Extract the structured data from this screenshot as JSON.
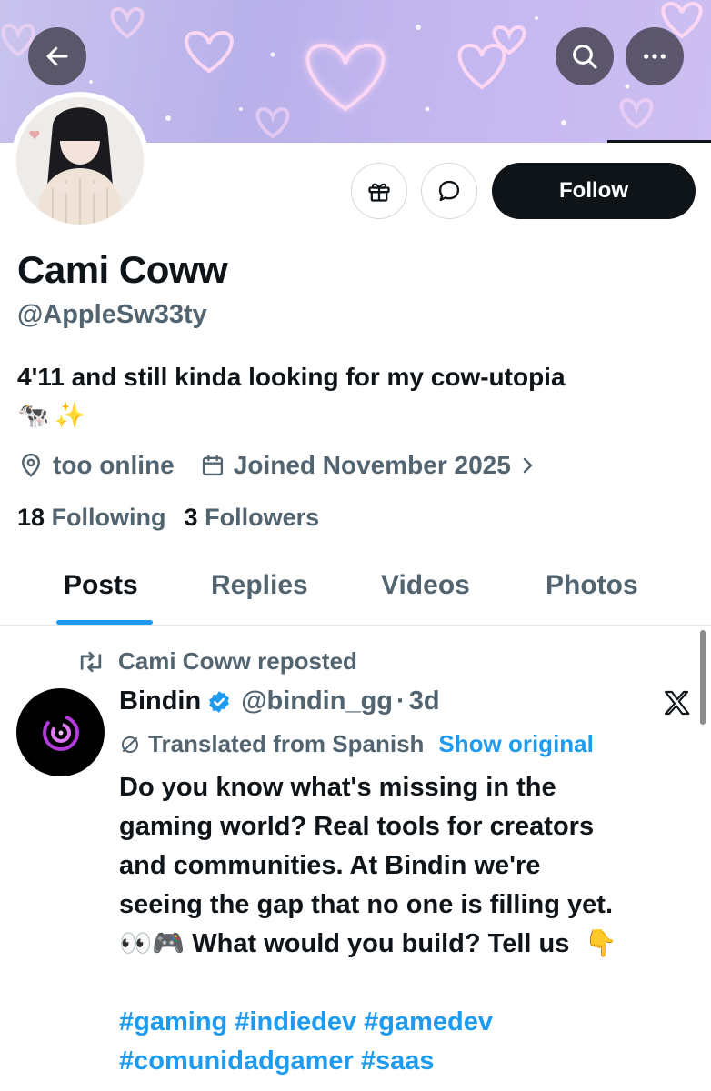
{
  "header": {
    "back_icon": "arrow-left-icon",
    "search_icon": "search-icon",
    "more_icon": "more-horizontal-icon"
  },
  "profile": {
    "name": "Cami Coww",
    "handle": "@AppleSw33ty",
    "bio": "4'11 and still kinda looking for my cow-utopia",
    "bio_emoji": [
      "🐄",
      "✨"
    ],
    "location": "too online",
    "joined": "Joined November 2025"
  },
  "actions": {
    "gift_icon": "gift-icon",
    "message_icon": "message-icon",
    "follow_label": "Follow"
  },
  "counts": {
    "following_count": "18",
    "following_label": "Following",
    "followers_count": "3",
    "followers_label": "Followers"
  },
  "tabs": [
    {
      "label": "Posts",
      "active": true
    },
    {
      "label": "Replies",
      "active": false
    },
    {
      "label": "Videos",
      "active": false
    },
    {
      "label": "Photos",
      "active": false
    }
  ],
  "post": {
    "repost_text": "Cami Coww reposted",
    "author_name": "Bindin",
    "verified": true,
    "author_handle": "@bindin_gg",
    "separator": "·",
    "time": "3d",
    "translated_text": "Translated from Spanish",
    "show_original": "Show original",
    "text_lines": [
      "Do you know what's missing in the",
      "gaming world? Real tools for creators",
      "and communities. At Bindin we're",
      "seeing the gap that no one is filling yet."
    ],
    "last_line_emoji": [
      "👀",
      "🎮"
    ],
    "last_line_text": "What would you build? Tell us",
    "pointing_emoji": "👇",
    "hashtags_line1": "#gaming #indiedev #gamedev",
    "hashtags_line2": "#comunidadgamer #saas"
  },
  "colors": {
    "accent": "#1d9bf0",
    "text_primary": "#0f1419",
    "text_secondary": "#536471",
    "verified": "#1d9bf0",
    "banner": "#c2b9ee"
  }
}
